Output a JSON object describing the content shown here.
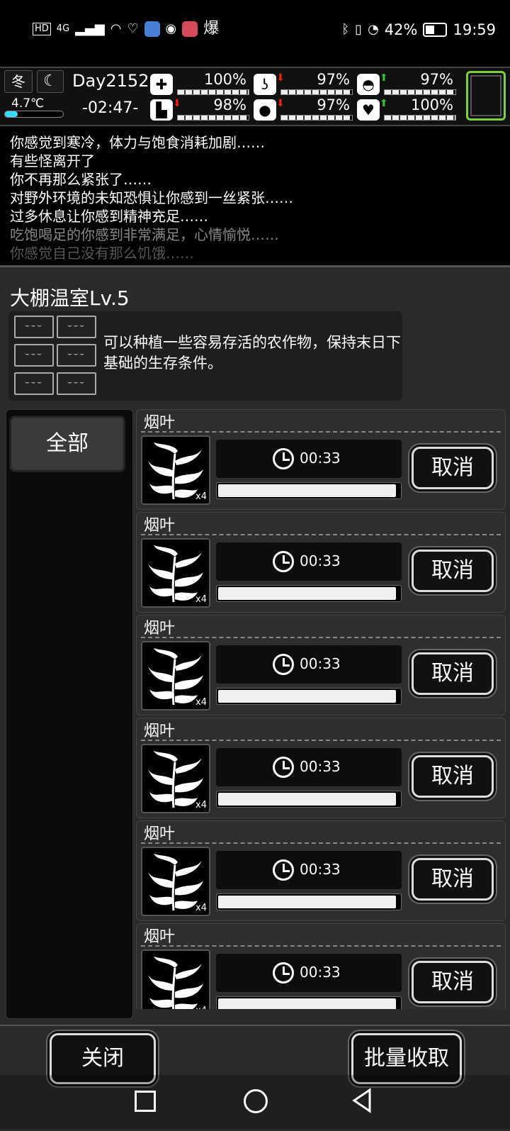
{
  "status_bar": {
    "left_icons": [
      "hd-icon",
      "4g-signal-icon",
      "wifi-icon",
      "health-icon",
      "music-app-icon",
      "browser-app-icon",
      "red-app-icon",
      "explode-app-icon"
    ],
    "left_texts": {
      "hd": "HD",
      "net": "4G",
      "explode": "爆"
    },
    "battery_percent": "42%",
    "time": "19:59"
  },
  "hud": {
    "season": "冬",
    "temperature": "4.7℃",
    "day": "Day2152",
    "clock": "-02:47-",
    "stats": [
      {
        "name": "health",
        "icon": "medkit-icon",
        "value": "100%",
        "level": 1.0,
        "trend": ""
      },
      {
        "name": "hunger",
        "icon": "stomach-icon",
        "value": "97%",
        "level": 0.97,
        "trend": "down"
      },
      {
        "name": "mood",
        "icon": "face-icon",
        "value": "97%",
        "level": 0.97,
        "trend": "up"
      },
      {
        "name": "stamina",
        "icon": "boot-icon",
        "value": "98%",
        "level": 0.98,
        "trend": "down"
      },
      {
        "name": "thirst",
        "icon": "water-drop-icon",
        "value": "97%",
        "level": 0.97,
        "trend": "down"
      },
      {
        "name": "spirit",
        "icon": "heart-icon",
        "value": "100%",
        "level": 1.0,
        "trend": "up"
      }
    ]
  },
  "log": [
    "你感觉到寒冷，体力与饱食消耗加剧……",
    "有些怪离开了",
    "你不再那么紧张了……",
    "对野外环境的未知恐惧让你感到一丝紧张……",
    "过多休息让你感到精神充足……",
    "吃饱喝足的你感到非常满足，心情愉悦……",
    "你感觉自己没有那么饥饿……"
  ],
  "panel": {
    "title": "大棚温室Lv.5",
    "description": "可以种植一些容易存活的农作物，保持末日下基础的生存条件。",
    "tab_all": "全部",
    "items": [
      {
        "name": "烟叶",
        "qty": "x4",
        "time": "00:33",
        "progress": 0.98,
        "cancel": "取消"
      },
      {
        "name": "烟叶",
        "qty": "x4",
        "time": "00:33",
        "progress": 0.98,
        "cancel": "取消"
      },
      {
        "name": "烟叶",
        "qty": "x4",
        "time": "00:33",
        "progress": 0.98,
        "cancel": "取消"
      },
      {
        "name": "烟叶",
        "qty": "x4",
        "time": "00:33",
        "progress": 0.98,
        "cancel": "取消"
      },
      {
        "name": "烟叶",
        "qty": "x4",
        "time": "00:33",
        "progress": 0.98,
        "cancel": "取消"
      },
      {
        "name": "烟叶",
        "qty": "x4",
        "time": "00:33",
        "progress": 0.98,
        "cancel": "取消"
      }
    ],
    "close_label": "关闭",
    "harvest_all_label": "批量收取"
  }
}
